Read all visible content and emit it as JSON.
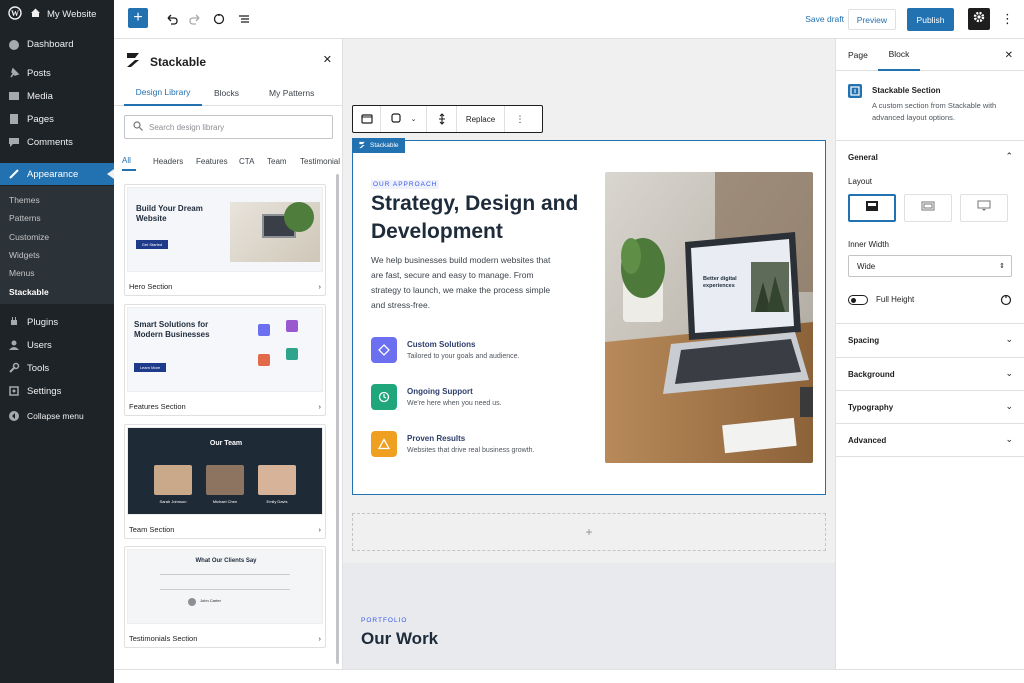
{
  "admin": {
    "site_name": "My Website",
    "menu": [
      {
        "label": "Dashboard",
        "icon": "dashboard-icon"
      },
      {
        "label": "Posts",
        "icon": "pin-icon"
      },
      {
        "label": "Media",
        "icon": "media-icon"
      },
      {
        "label": "Pages",
        "icon": "pages-icon"
      },
      {
        "label": "Comments",
        "icon": "comment-icon"
      },
      {
        "label": "Appearance",
        "icon": "brush-icon"
      },
      {
        "label": "Plugins",
        "icon": "plug-icon"
      },
      {
        "label": "Users",
        "icon": "user-icon"
      },
      {
        "label": "Tools",
        "icon": "wrench-icon"
      },
      {
        "label": "Settings",
        "icon": "settings-icon"
      },
      {
        "label": "Collapse menu",
        "icon": "collapse-icon"
      }
    ],
    "submenu": [
      "Themes",
      "Patterns",
      "Customize",
      "Widgets",
      "Menus",
      "Stackable"
    ]
  },
  "topbar": {
    "save_draft": "Save draft",
    "preview": "Preview",
    "publish": "Publish"
  },
  "library": {
    "title": "Stackable",
    "tabs": [
      "Design Library",
      "Blocks",
      "My Patterns"
    ],
    "search_placeholder": "Search design library",
    "categories": [
      "All",
      "Headers",
      "Features",
      "CTA",
      "Team",
      "Testimonial"
    ],
    "cards": [
      {
        "name": "Hero Section",
        "thumb_title": "Build Your Dream Website",
        "button": "Get Started"
      },
      {
        "name": "Features Section",
        "thumb_title": "Smart Solutions for Modern Businesses",
        "button": "Learn More"
      },
      {
        "name": "Team Section",
        "thumb_title": "Our Team",
        "members": [
          "Sarah Johnson",
          "Michael Chen",
          "Emily Davis"
        ]
      },
      {
        "name": "Testimonials Section",
        "thumb_title": "What Our Clients Say",
        "person": "John Carter"
      }
    ]
  },
  "toolbar": {
    "replace": "Replace"
  },
  "section": {
    "label": "Stackable",
    "eyebrow": "OUR APPROACH",
    "heading": "Strategy, Design and Development",
    "paragraph": "We help businesses build modern websites that are fast, secure and easy to manage. From strategy to launch, we make the process simple and stress-free.",
    "features": [
      {
        "title": "Custom Solutions",
        "desc": "Tailored to your goals and audience.",
        "color": "#6b6ff0"
      },
      {
        "title": "Ongoing Support",
        "desc": "We're here when you need us.",
        "color": "#1fa67a"
      },
      {
        "title": "Proven Results",
        "desc": "Websites that drive real business growth.",
        "color": "#f0a020"
      }
    ],
    "laptop_text": "Better digital experiences"
  },
  "work": {
    "eyebrow": "PORTFOLIO",
    "heading": "Our Work"
  },
  "sidebar": {
    "tabs": [
      "Page",
      "Block"
    ],
    "block_title": "Stackable Section",
    "block_desc": "A custom section from Stackable with advanced layout options.",
    "general": "General",
    "layout_label": "Layout",
    "inner_width_label": "Inner Width",
    "inner_width_value": "Wide",
    "full_height": "Full Height",
    "panels": [
      "Spacing",
      "Background",
      "Typography",
      "Advanced"
    ]
  }
}
